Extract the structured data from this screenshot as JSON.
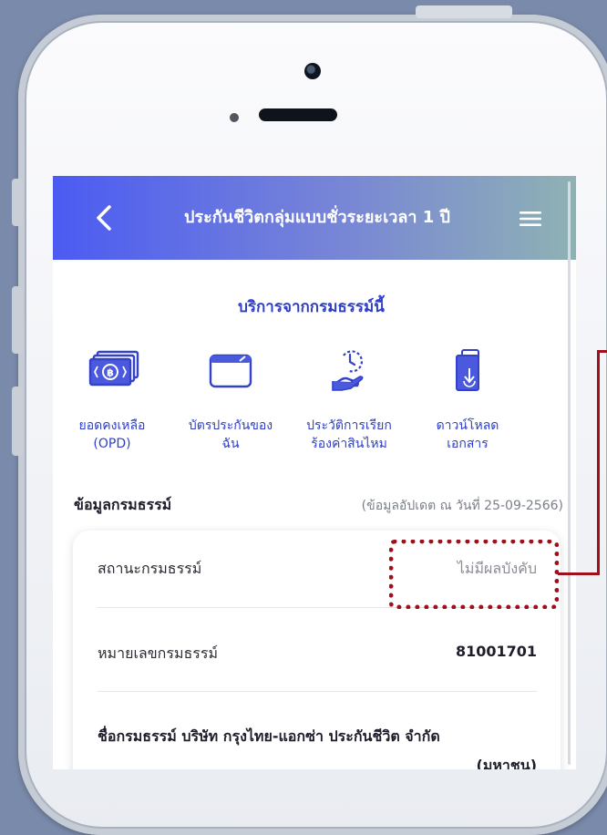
{
  "header": {
    "title": "ประกันชีวิตกลุ่มแบบชั่วระยะเวลา 1 ปี",
    "back_icon": "chevron-left-icon",
    "menu_icon": "hamburger-menu-icon"
  },
  "services": {
    "title": "บริการจากกรมธรรม์นี้",
    "items": [
      {
        "icon": "cash-stack-icon",
        "line1": "ยอดคงเหลือ",
        "line2": "(OPD)"
      },
      {
        "icon": "card-icon",
        "line1": "บัตรประกันของ",
        "line2": "ฉัน"
      },
      {
        "icon": "claim-history-hand-icon",
        "line1": "ประวัติการเรียก",
        "line2": "ร้องค่าสินไหม"
      },
      {
        "icon": "document-download-icon",
        "line1": "ดาวน์โหลด",
        "line2": "เอกสาร"
      }
    ]
  },
  "policy_info": {
    "title": "ข้อมูลกรมธรรม์",
    "updated": "(ข้อมูลอัปเดต ณ วันที่ 25-09-2566)",
    "status_label": "สถานะกรมธรรม์",
    "status_value": "ไม่มีผลบังคับ",
    "number_label": "หมายเลขกรมธรรม์",
    "number_value": "81001701",
    "name_label": "ชื่อกรมธรรม์",
    "name_value": "บริษัท กรุงไทย-แอกซ่า ประกันชีวิต จำกัด",
    "name_value_cont": "(มหาชน)"
  },
  "colors": {
    "accent": "#2e3fc6",
    "header_start": "#4b5bf2",
    "header_end": "#8fb3b2",
    "callout": "#a0101c",
    "status_text": "#8a8d94"
  }
}
